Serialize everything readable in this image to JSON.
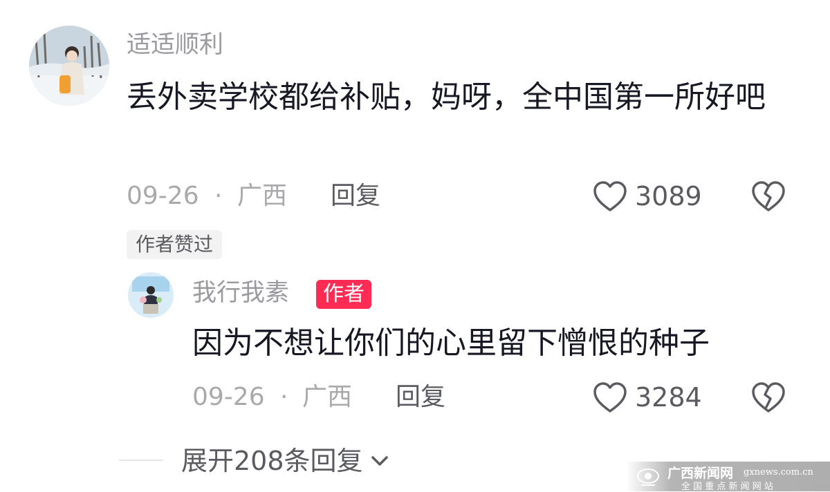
{
  "comment": {
    "username": "适适顺利",
    "text": "丢外卖学校都给补贴，妈呀，全中国第一所好吧",
    "date": "09-26",
    "separator": "·",
    "location": "广西",
    "reply_label": "回复",
    "like_count": "3089",
    "liked_badge": "作者赞过"
  },
  "reply": {
    "username": "我行我素",
    "author_badge": "作者",
    "text": "因为不想让你们的心里留下憎恨的种子",
    "date": "09-26",
    "separator": "·",
    "location": "广西",
    "reply_label": "回复",
    "like_count": "3284"
  },
  "expand": {
    "label": "展开208条回复"
  },
  "watermark": {
    "brand": "广西新闻网",
    "domain": "gxnews.com.cn",
    "tagline": "全 国 重 点 新 闻 网 站"
  },
  "colors": {
    "primary_text": "#161823",
    "secondary_text": "#a8a9ad",
    "author_badge": "#fe2c55"
  }
}
